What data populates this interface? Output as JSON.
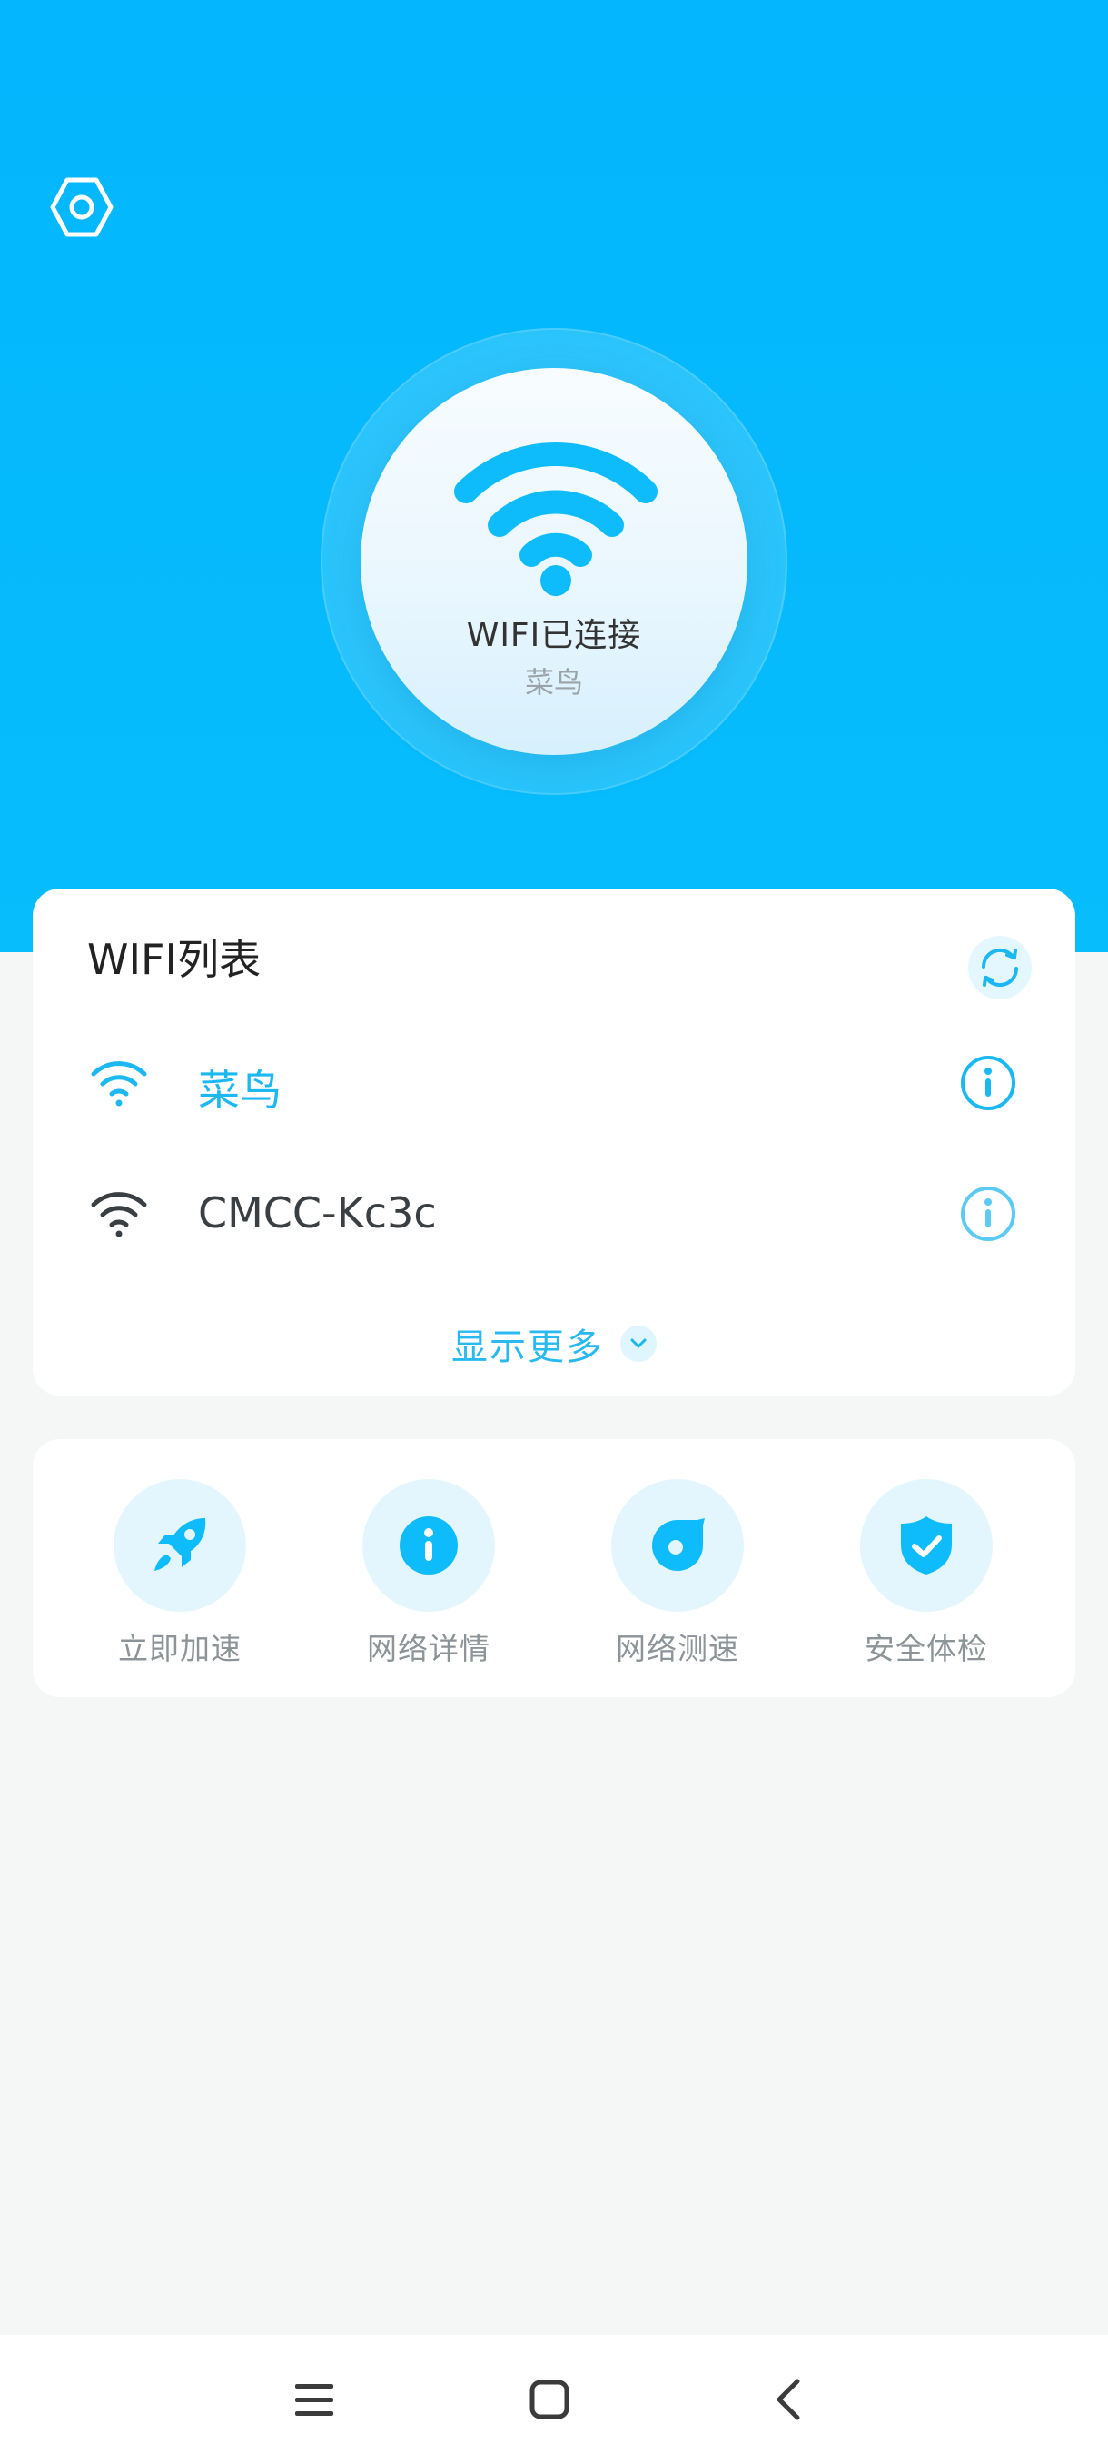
{
  "header": {
    "settings_icon": "hexagon-gear-icon",
    "status_title": "WIFI已连接",
    "connected_ssid": "菜鸟"
  },
  "wifi_list": {
    "title": "WIFI列表",
    "refresh_icon": "refresh-icon",
    "networks": [
      {
        "name": "菜鸟",
        "connected": true,
        "icon": "wifi-icon",
        "info_icon": "info-icon",
        "color": "#1bb8f2"
      },
      {
        "name": "CMCC-Kc3c",
        "connected": false,
        "icon": "wifi-icon",
        "info_icon": "info-icon",
        "color": "#3a3f43"
      }
    ],
    "show_more_label": "显示更多"
  },
  "tools": [
    {
      "label": "立即加速",
      "icon": "rocket-icon"
    },
    {
      "label": "网络详情",
      "icon": "info-icon"
    },
    {
      "label": "网络测速",
      "icon": "speedometer-icon"
    },
    {
      "label": "安全体检",
      "icon": "shield-check-icon"
    }
  ],
  "navbar": {
    "menu_icon": "menu-icon",
    "home_icon": "home-square-icon",
    "back_icon": "back-chevron-icon"
  },
  "colors": {
    "accent": "#09bbfc",
    "accent_text": "#1bb8f2",
    "header_bg": "#03b6fd"
  }
}
